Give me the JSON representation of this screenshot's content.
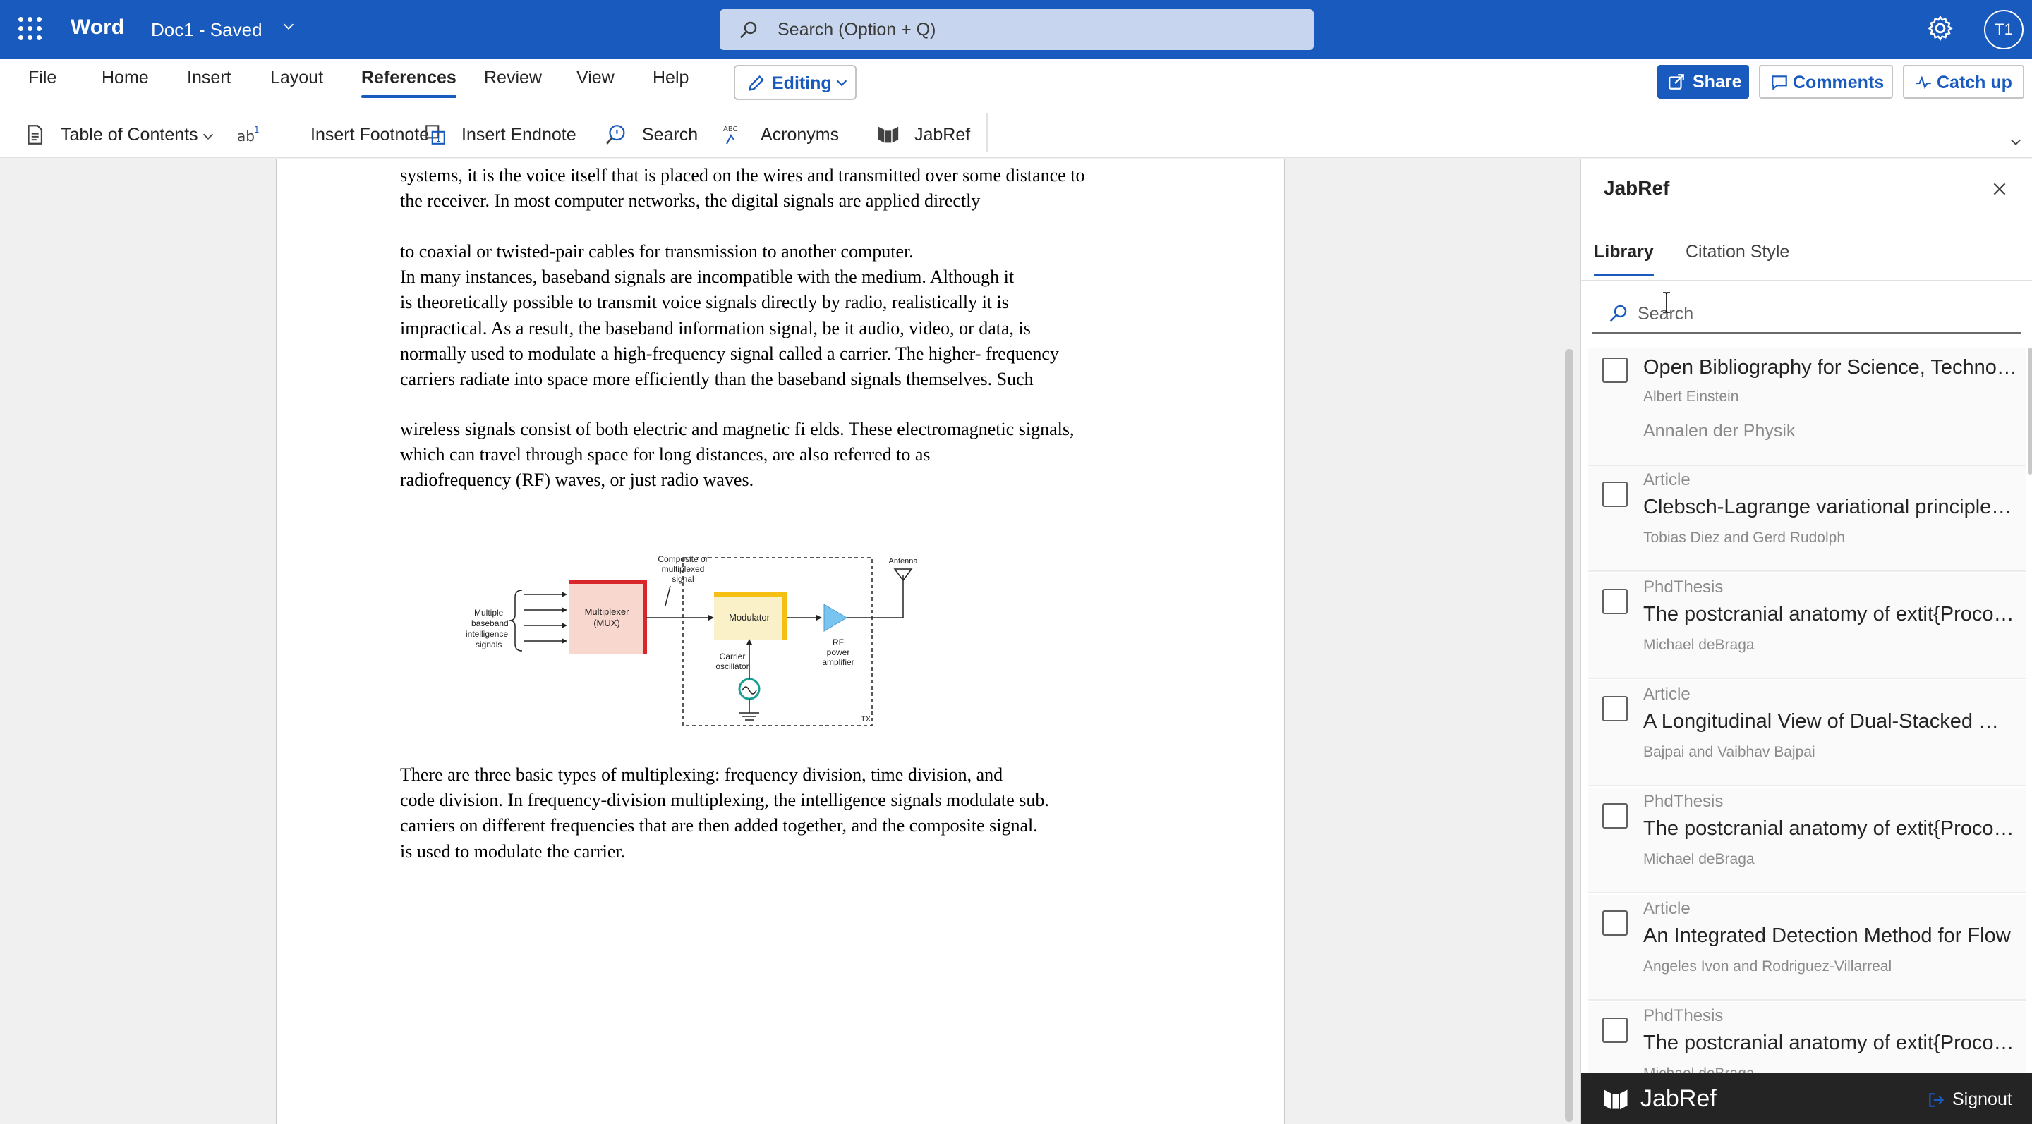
{
  "titlebar": {
    "app_name": "Word",
    "doc_title": "Doc1 - Saved",
    "search_placeholder": "Search (Option + Q)",
    "avatar_initials": "T1"
  },
  "ribbon": {
    "tabs": [
      "File",
      "Home",
      "Insert",
      "Layout",
      "References",
      "Review",
      "View",
      "Help"
    ],
    "active_tab": "References",
    "editing_label": "Editing",
    "share_label": "Share",
    "comments_label": "Comments",
    "catchup_label": "Catch up",
    "commands": {
      "toc": "Table of Contents",
      "footnote": "Insert Footnote",
      "endnote": "Insert Endnote",
      "search": "Search",
      "acronyms": "Acronyms",
      "jabref": "JabRef"
    }
  },
  "document": {
    "paragraph1": [
      "systems, it is the voice itself that is placed on the wires and transmitted over some distance to",
      "the receiver. In most computer networks, the digital signals are applied directly"
    ],
    "paragraph2": [
      "to coaxial or twisted-pair cables for transmission to another computer.",
      "In many instances, baseband signals are incompatible with the medium. Although it",
      "is theoretically possible to transmit voice signals directly by radio, realistically it is",
      "impractical. As a result, the baseband information signal, be it audio, video, or data, is",
      "normally used to modulate a high-frequency signal called a carrier. The higher- frequency",
      "carriers radiate into space more efficiently than the baseband signals themselves. Such"
    ],
    "paragraph3": [
      "wireless signals consist of both electric and magnetic fi elds. These electromagnetic signals,",
      "which can travel through space for long distances, are also referred to as",
      "radiofrequency (RF) waves, or just radio waves."
    ],
    "paragraph4": [
      "There are three basic types of multiplexing: frequency division, time division, and",
      "code division. In frequency-division multiplexing, the intelligence signals modulate sub.",
      "carriers on different frequencies that are then added together, and the composite signal.",
      "is used to modulate the carrier."
    ],
    "figure": {
      "inputs_label": [
        "Multiple",
        "baseband",
        "intelligence",
        "signals"
      ],
      "mux_label": [
        "Multiplexer",
        "(MUX)"
      ],
      "composite_label": [
        "Composite or",
        "multiplexed",
        "signal"
      ],
      "modulator_label": "Modulator",
      "oscillator_label": [
        "Carrier",
        "oscillator"
      ],
      "amplifier_label": [
        "RF",
        "power",
        "amplifier"
      ],
      "antenna_label": "Antenna",
      "tx_label": "TX"
    }
  },
  "pane": {
    "title": "JabRef",
    "tabs": [
      "Library",
      "Citation Style"
    ],
    "active_tab": "Library",
    "search_placeholder": "Search",
    "entries": [
      {
        "type": "",
        "title": "Open Bibliography for Science, Technology",
        "author": "Albert Einstein",
        "journal": "Annalen der Physik"
      },
      {
        "type": "Article",
        "title": "Clebsch-Lagrange variational principle and",
        "author": "Tobias Diez and Gerd Rudolph",
        "journal": ""
      },
      {
        "type": "PhdThesis",
        "title": "The postcranial anatomy of extit{Procolophon",
        "author": "Michael deBraga",
        "journal": ""
      },
      {
        "type": "Article",
        "title": "A Longitudinal View of Dual-Stacked Websites",
        "author": "Bajpai and Vaibhav Bajpai",
        "journal": ""
      },
      {
        "type": "PhdThesis",
        "title": "The postcranial anatomy of extit{Procolophon",
        "author": "Michael deBraga",
        "journal": ""
      },
      {
        "type": "Article",
        "title": "An Integrated Detection Method for Flow",
        "author": "Angeles Ivon and Rodriguez-Villarreal",
        "journal": ""
      },
      {
        "type": "PhdThesis",
        "title": "The postcranial anatomy of extit{Procolophon",
        "author": "Michael deBraga",
        "journal": ""
      }
    ],
    "footer_name": "JabRef",
    "signout_label": "Signout"
  },
  "colors": {
    "brand_blue": "#185abd",
    "footer_dark": "#242424"
  }
}
